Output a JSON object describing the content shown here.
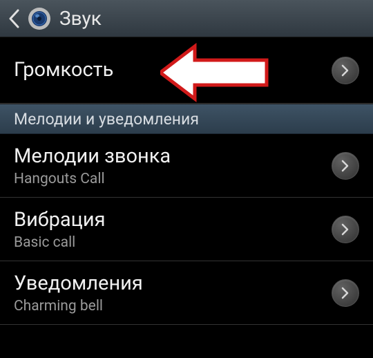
{
  "header": {
    "title": "Звук"
  },
  "items": {
    "volume": {
      "title": "Громкость"
    },
    "ringtones": {
      "title": "Мелодии звонка",
      "subtitle": "Hangouts Call"
    },
    "vibration": {
      "title": "Вибрация",
      "subtitle": "Basic call"
    },
    "notifications": {
      "title": "Уведомления",
      "subtitle": "Charming bell"
    }
  },
  "section": {
    "melodies": "Мелодии и уведомления"
  }
}
